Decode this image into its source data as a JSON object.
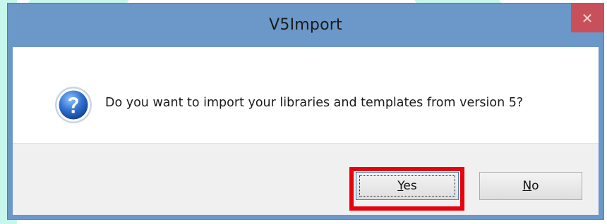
{
  "window": {
    "title": "V5Import",
    "close_glyph": "✕"
  },
  "message": {
    "icon": "question-icon",
    "text": "Do you want to import your libraries and templates from version 5?"
  },
  "buttons": {
    "yes_accel": "Y",
    "yes_rest": "es",
    "no_accel": "N",
    "no_rest": "o"
  },
  "colors": {
    "titlebar": "#6b98c8",
    "close_button": "#c7505a",
    "highlight": "#e8000b",
    "button_area": "#f0f0f0"
  }
}
